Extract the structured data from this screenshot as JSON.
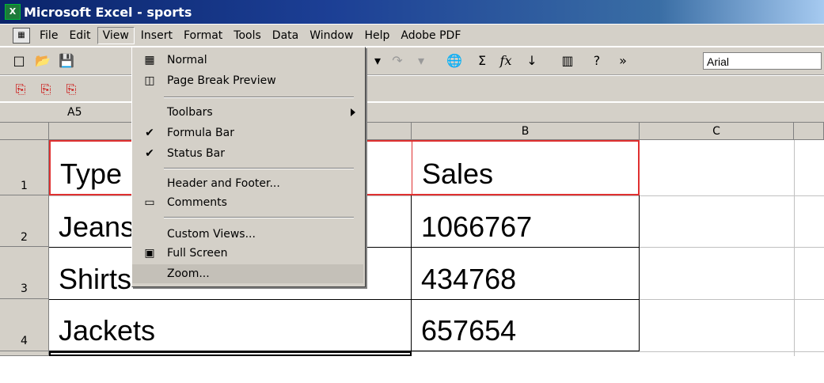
{
  "window": {
    "title": "Microsoft Excel - sports"
  },
  "menubar": {
    "items": [
      {
        "label": "File",
        "accel": "F"
      },
      {
        "label": "Edit",
        "accel": "E"
      },
      {
        "label": "View",
        "accel": "V"
      },
      {
        "label": "Insert",
        "accel": "I"
      },
      {
        "label": "Format",
        "accel": "o"
      },
      {
        "label": "Tools",
        "accel": "T"
      },
      {
        "label": "Data",
        "accel": "D"
      },
      {
        "label": "Window",
        "accel": "W"
      },
      {
        "label": "Help",
        "accel": "H"
      },
      {
        "label": "Adobe PDF",
        "accel": "b"
      }
    ]
  },
  "toolbar": {
    "font": "Arial"
  },
  "namebox": {
    "value": "A5"
  },
  "columns": [
    "A",
    "B",
    "C"
  ],
  "rows": [
    {
      "num": "1",
      "a": "Type",
      "b": "Sales"
    },
    {
      "num": "2",
      "a": "Jeans",
      "b": "1066767"
    },
    {
      "num": "3",
      "a": "Shirts",
      "b": "434768"
    },
    {
      "num": "4",
      "a": "Jackets",
      "b": "657654"
    }
  ],
  "view_menu": {
    "normal": "Normal",
    "page_break_preview": "Page Break Preview",
    "toolbars": "Toolbars",
    "formula_bar": "Formula Bar",
    "status_bar": "Status Bar",
    "header_footer": "Header and Footer...",
    "comments": "Comments",
    "custom_views": "Custom Views...",
    "full_screen": "Full Screen",
    "zoom": "Zoom..."
  },
  "colors": {
    "chrome": "#d4d0c8",
    "title_bar": "#0a246a",
    "selection_border": "#e03030"
  }
}
